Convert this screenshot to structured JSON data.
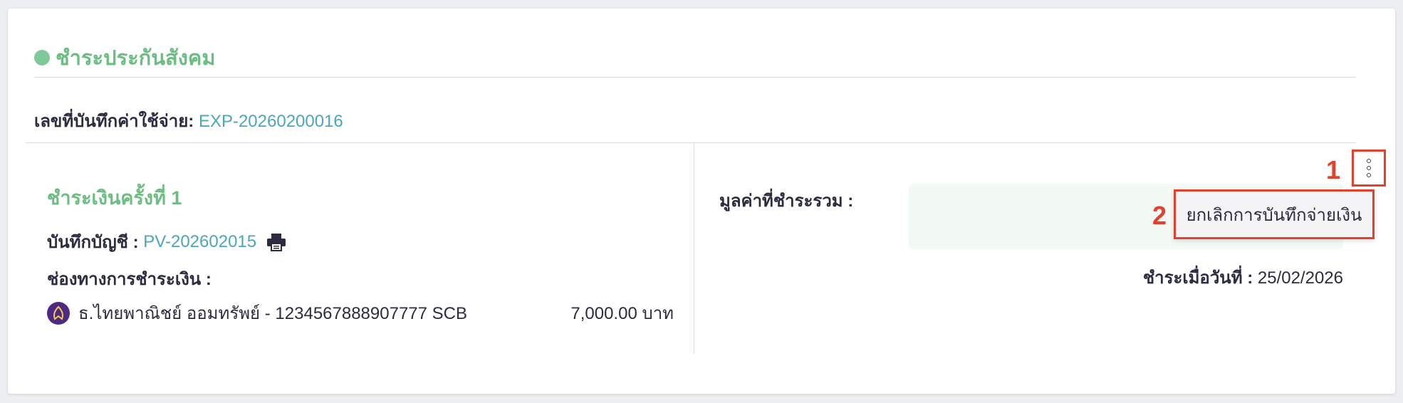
{
  "section": {
    "title": "ชำระประกันสังคม"
  },
  "expense": {
    "label": "เลขที่บันทึกค่าใช้จ่าย:",
    "value": "EXP-20260200016"
  },
  "payment": {
    "title": "ชำระเงินครั้งที่ 1",
    "ledger_label": "บันทึกบัญชี :",
    "ledger_value": "PV-202602015",
    "channel_label": "ช่องทางการชำระเงิน :",
    "bank_name": "ธ.ไทยพาณิชย์ ออมทรัพย์ - 1234567888907777 SCB",
    "amount": "7,000.00 บาท"
  },
  "summary": {
    "total_label": "มูลค่าที่ชำระรวม :",
    "paid_date_label": "ชำระเมื่อวันที่ :",
    "paid_date_value": "25/02/2026"
  },
  "actions": {
    "menu_icon": "kebab-icon",
    "cancel_label": "ยกเลิกการบันทึกจ่ายเงิน"
  },
  "annotations": {
    "marker1": "1",
    "marker2": "2"
  },
  "colors": {
    "accent_green": "#6cbd82",
    "link": "#4aa6bd",
    "highlight": "#e2412e",
    "bank_purple": "#4e2a84"
  }
}
